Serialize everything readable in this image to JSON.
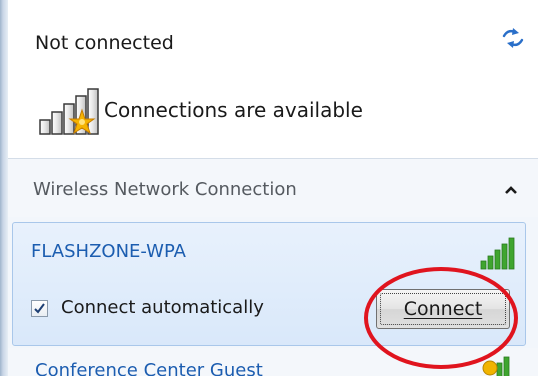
{
  "header": {
    "title": "Not connected",
    "refresh_icon": "refresh-arrows-icon"
  },
  "status": {
    "icon": "signal-bars-star-icon",
    "text": "Connections are available"
  },
  "section": {
    "label": "Wireless Network Connection",
    "caret_icon": "chevron-up-icon"
  },
  "networks": [
    {
      "name": "FLASHZONE-WPA",
      "signal_icon": "signal-strength-icon",
      "connect_automatically_label": "Connect automatically",
      "connect_automatically_checked": true,
      "connect_button_label": "Connect"
    },
    {
      "name": "Conference Center Guest",
      "signal_icon": "signal-strength-warning-icon"
    }
  ],
  "colors": {
    "network_name": "#1c5db0",
    "selected_item_bg": "#dce9fa",
    "highlight": "#e0141e"
  }
}
